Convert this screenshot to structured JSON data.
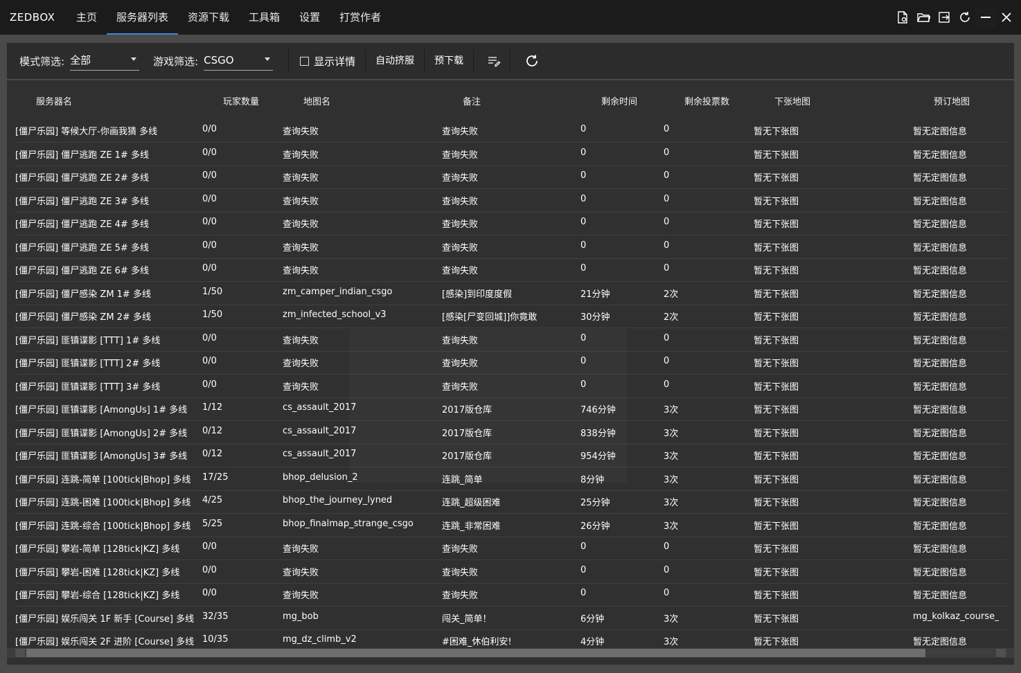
{
  "app": {
    "title": "ZEDBOX"
  },
  "nav": {
    "tabs": [
      {
        "label": "主页"
      },
      {
        "label": "服务器列表",
        "active": true
      },
      {
        "label": "资源下载"
      },
      {
        "label": "工具箱"
      },
      {
        "label": "设置"
      },
      {
        "label": "打赏作者"
      }
    ]
  },
  "window_controls": {
    "icons": [
      "file-settings-icon",
      "folder-open-icon",
      "exit-icon",
      "refresh-icon",
      "minimize-icon",
      "close-icon"
    ]
  },
  "toolbar": {
    "mode_label": "模式筛选:",
    "mode_value": "全部",
    "game_label": "游戏筛选:",
    "game_value": "CSGO",
    "show_details_label": "显示详情",
    "show_details_checked": false,
    "auto_squeeze_label": "自动挤服",
    "pre_download_label": "预下载",
    "icons": [
      "list-edit-icon",
      "refresh-icon"
    ]
  },
  "table": {
    "columns": [
      "服务器名",
      "玩家数量",
      "地图名",
      "备注",
      "剩余时间",
      "剩余投票数",
      "下张地图",
      "预订地图"
    ],
    "rows": [
      [
        "[僵尸乐园] 等候大厅-你画我猜 多线",
        "0/0",
        "查询失败",
        "查询失败",
        "0",
        "0",
        "暂无下张图",
        "暂无定图信息"
      ],
      [
        "[僵尸乐园] 僵尸逃跑 ZE 1# 多线",
        "0/0",
        "查询失败",
        "查询失败",
        "0",
        "0",
        "暂无下张图",
        "暂无定图信息"
      ],
      [
        "[僵尸乐园] 僵尸逃跑 ZE 2# 多线",
        "0/0",
        "查询失败",
        "查询失败",
        "0",
        "0",
        "暂无下张图",
        "暂无定图信息"
      ],
      [
        "[僵尸乐园] 僵尸逃跑 ZE 3# 多线",
        "0/0",
        "查询失败",
        "查询失败",
        "0",
        "0",
        "暂无下张图",
        "暂无定图信息"
      ],
      [
        "[僵尸乐园] 僵尸逃跑 ZE 4# 多线",
        "0/0",
        "查询失败",
        "查询失败",
        "0",
        "0",
        "暂无下张图",
        "暂无定图信息"
      ],
      [
        "[僵尸乐园] 僵尸逃跑 ZE 5# 多线",
        "0/0",
        "查询失败",
        "查询失败",
        "0",
        "0",
        "暂无下张图",
        "暂无定图信息"
      ],
      [
        "[僵尸乐园] 僵尸逃跑 ZE 6# 多线",
        "0/0",
        "查询失败",
        "查询失败",
        "0",
        "0",
        "暂无下张图",
        "暂无定图信息"
      ],
      [
        "[僵尸乐园] 僵尸感染 ZM 1# 多线",
        "1/50",
        "zm_camper_indian_csgo",
        "[感染]到印度度假",
        "21分钟",
        "2次",
        "暂无下张图",
        "暂无定图信息"
      ],
      [
        "[僵尸乐园] 僵尸感染 ZM 2# 多线",
        "1/50",
        "zm_infected_school_v3",
        "[感染[尸变回城]]你竟敢",
        "30分钟",
        "2次",
        "暂无下张图",
        "暂无定图信息"
      ],
      [
        "[僵尸乐园] 匪镇谍影 [TTT] 1# 多线",
        "0/0",
        "查询失败",
        "查询失败",
        "0",
        "0",
        "暂无下张图",
        "暂无定图信息"
      ],
      [
        "[僵尸乐园] 匪镇谍影 [TTT] 2# 多线",
        "0/0",
        "查询失败",
        "查询失败",
        "0",
        "0",
        "暂无下张图",
        "暂无定图信息"
      ],
      [
        "[僵尸乐园] 匪镇谍影 [TTT] 3# 多线",
        "0/0",
        "查询失败",
        "查询失败",
        "0",
        "0",
        "暂无下张图",
        "暂无定图信息"
      ],
      [
        "[僵尸乐园] 匪镇谍影 [AmongUs] 1# 多线",
        "1/12",
        "cs_assault_2017",
        "2017版仓库",
        "746分钟",
        "3次",
        "暂无下张图",
        "暂无定图信息"
      ],
      [
        "[僵尸乐园] 匪镇谍影 [AmongUs] 2# 多线",
        "0/12",
        "cs_assault_2017",
        "2017版仓库",
        "838分钟",
        "3次",
        "暂无下张图",
        "暂无定图信息"
      ],
      [
        "[僵尸乐园] 匪镇谍影 [AmongUs] 3# 多线",
        "0/12",
        "cs_assault_2017",
        "2017版仓库",
        "954分钟",
        "3次",
        "暂无下张图",
        "暂无定图信息"
      ],
      [
        "[僵尸乐园] 连跳-简单 [100tick|Bhop] 多线",
        "17/25",
        "bhop_delusion_2",
        "连跳_简单",
        "8分钟",
        "3次",
        "暂无下张图",
        "暂无定图信息"
      ],
      [
        "[僵尸乐园] 连跳-困难 [100tick|Bhop] 多线",
        "4/25",
        "bhop_the_journey_lyned",
        "连跳_超级困难",
        "25分钟",
        "3次",
        "暂无下张图",
        "暂无定图信息"
      ],
      [
        "[僵尸乐园] 连跳-综合 [100tick|Bhop] 多线",
        "5/25",
        "bhop_finalmap_strange_csgo",
        "连跳_非常困难",
        "26分钟",
        "3次",
        "暂无下张图",
        "暂无定图信息"
      ],
      [
        "[僵尸乐园] 攀岩-简单 [128tick|KZ] 多线",
        "0/0",
        "查询失败",
        "查询失败",
        "0",
        "0",
        "暂无下张图",
        "暂无定图信息"
      ],
      [
        "[僵尸乐园] 攀岩-困难 [128tick|KZ] 多线",
        "0/0",
        "查询失败",
        "查询失败",
        "0",
        "0",
        "暂无下张图",
        "暂无定图信息"
      ],
      [
        "[僵尸乐园] 攀岩-综合 [128tick|KZ] 多线",
        "0/0",
        "查询失败",
        "查询失败",
        "0",
        "0",
        "暂无下张图",
        "暂无定图信息"
      ],
      [
        "[僵尸乐园] 娱乐闯关 1F 新手 [Course] 多线",
        "32/35",
        "mg_bob",
        "闯关_简单！",
        "6分钟",
        "3次",
        "暂无下张图",
        "mg_kolkaz_course_v"
      ],
      [
        "[僵尸乐园] 娱乐闯关 2F 进阶 [Course] 多线",
        "10/35",
        "mg_dz_climb_v2",
        "#困难_休伯利安!",
        "4分钟",
        "3次",
        "暂无下张图",
        "暂无定图信息"
      ]
    ]
  }
}
